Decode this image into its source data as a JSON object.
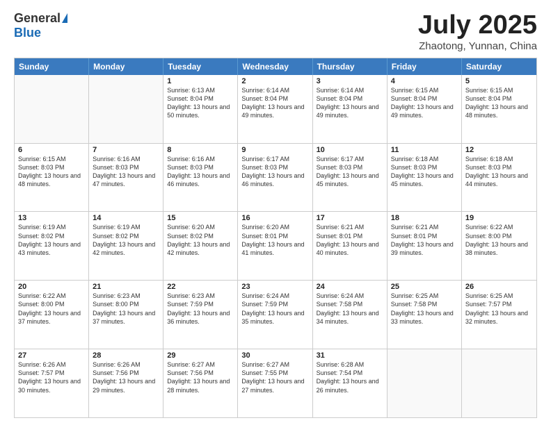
{
  "logo": {
    "general": "General",
    "blue": "Blue"
  },
  "title": {
    "month": "July 2025",
    "location": "Zhaotong, Yunnan, China"
  },
  "header_days": [
    "Sunday",
    "Monday",
    "Tuesday",
    "Wednesday",
    "Thursday",
    "Friday",
    "Saturday"
  ],
  "weeks": [
    [
      {
        "day": "",
        "sunrise": "",
        "sunset": "",
        "daylight": ""
      },
      {
        "day": "",
        "sunrise": "",
        "sunset": "",
        "daylight": ""
      },
      {
        "day": "1",
        "sunrise": "Sunrise: 6:13 AM",
        "sunset": "Sunset: 8:04 PM",
        "daylight": "Daylight: 13 hours and 50 minutes."
      },
      {
        "day": "2",
        "sunrise": "Sunrise: 6:14 AM",
        "sunset": "Sunset: 8:04 PM",
        "daylight": "Daylight: 13 hours and 49 minutes."
      },
      {
        "day": "3",
        "sunrise": "Sunrise: 6:14 AM",
        "sunset": "Sunset: 8:04 PM",
        "daylight": "Daylight: 13 hours and 49 minutes."
      },
      {
        "day": "4",
        "sunrise": "Sunrise: 6:15 AM",
        "sunset": "Sunset: 8:04 PM",
        "daylight": "Daylight: 13 hours and 49 minutes."
      },
      {
        "day": "5",
        "sunrise": "Sunrise: 6:15 AM",
        "sunset": "Sunset: 8:04 PM",
        "daylight": "Daylight: 13 hours and 48 minutes."
      }
    ],
    [
      {
        "day": "6",
        "sunrise": "Sunrise: 6:15 AM",
        "sunset": "Sunset: 8:03 PM",
        "daylight": "Daylight: 13 hours and 48 minutes."
      },
      {
        "day": "7",
        "sunrise": "Sunrise: 6:16 AM",
        "sunset": "Sunset: 8:03 PM",
        "daylight": "Daylight: 13 hours and 47 minutes."
      },
      {
        "day": "8",
        "sunrise": "Sunrise: 6:16 AM",
        "sunset": "Sunset: 8:03 PM",
        "daylight": "Daylight: 13 hours and 46 minutes."
      },
      {
        "day": "9",
        "sunrise": "Sunrise: 6:17 AM",
        "sunset": "Sunset: 8:03 PM",
        "daylight": "Daylight: 13 hours and 46 minutes."
      },
      {
        "day": "10",
        "sunrise": "Sunrise: 6:17 AM",
        "sunset": "Sunset: 8:03 PM",
        "daylight": "Daylight: 13 hours and 45 minutes."
      },
      {
        "day": "11",
        "sunrise": "Sunrise: 6:18 AM",
        "sunset": "Sunset: 8:03 PM",
        "daylight": "Daylight: 13 hours and 45 minutes."
      },
      {
        "day": "12",
        "sunrise": "Sunrise: 6:18 AM",
        "sunset": "Sunset: 8:03 PM",
        "daylight": "Daylight: 13 hours and 44 minutes."
      }
    ],
    [
      {
        "day": "13",
        "sunrise": "Sunrise: 6:19 AM",
        "sunset": "Sunset: 8:02 PM",
        "daylight": "Daylight: 13 hours and 43 minutes."
      },
      {
        "day": "14",
        "sunrise": "Sunrise: 6:19 AM",
        "sunset": "Sunset: 8:02 PM",
        "daylight": "Daylight: 13 hours and 42 minutes."
      },
      {
        "day": "15",
        "sunrise": "Sunrise: 6:20 AM",
        "sunset": "Sunset: 8:02 PM",
        "daylight": "Daylight: 13 hours and 42 minutes."
      },
      {
        "day": "16",
        "sunrise": "Sunrise: 6:20 AM",
        "sunset": "Sunset: 8:01 PM",
        "daylight": "Daylight: 13 hours and 41 minutes."
      },
      {
        "day": "17",
        "sunrise": "Sunrise: 6:21 AM",
        "sunset": "Sunset: 8:01 PM",
        "daylight": "Daylight: 13 hours and 40 minutes."
      },
      {
        "day": "18",
        "sunrise": "Sunrise: 6:21 AM",
        "sunset": "Sunset: 8:01 PM",
        "daylight": "Daylight: 13 hours and 39 minutes."
      },
      {
        "day": "19",
        "sunrise": "Sunrise: 6:22 AM",
        "sunset": "Sunset: 8:00 PM",
        "daylight": "Daylight: 13 hours and 38 minutes."
      }
    ],
    [
      {
        "day": "20",
        "sunrise": "Sunrise: 6:22 AM",
        "sunset": "Sunset: 8:00 PM",
        "daylight": "Daylight: 13 hours and 37 minutes."
      },
      {
        "day": "21",
        "sunrise": "Sunrise: 6:23 AM",
        "sunset": "Sunset: 8:00 PM",
        "daylight": "Daylight: 13 hours and 37 minutes."
      },
      {
        "day": "22",
        "sunrise": "Sunrise: 6:23 AM",
        "sunset": "Sunset: 7:59 PM",
        "daylight": "Daylight: 13 hours and 36 minutes."
      },
      {
        "day": "23",
        "sunrise": "Sunrise: 6:24 AM",
        "sunset": "Sunset: 7:59 PM",
        "daylight": "Daylight: 13 hours and 35 minutes."
      },
      {
        "day": "24",
        "sunrise": "Sunrise: 6:24 AM",
        "sunset": "Sunset: 7:58 PM",
        "daylight": "Daylight: 13 hours and 34 minutes."
      },
      {
        "day": "25",
        "sunrise": "Sunrise: 6:25 AM",
        "sunset": "Sunset: 7:58 PM",
        "daylight": "Daylight: 13 hours and 33 minutes."
      },
      {
        "day": "26",
        "sunrise": "Sunrise: 6:25 AM",
        "sunset": "Sunset: 7:57 PM",
        "daylight": "Daylight: 13 hours and 32 minutes."
      }
    ],
    [
      {
        "day": "27",
        "sunrise": "Sunrise: 6:26 AM",
        "sunset": "Sunset: 7:57 PM",
        "daylight": "Daylight: 13 hours and 30 minutes."
      },
      {
        "day": "28",
        "sunrise": "Sunrise: 6:26 AM",
        "sunset": "Sunset: 7:56 PM",
        "daylight": "Daylight: 13 hours and 29 minutes."
      },
      {
        "day": "29",
        "sunrise": "Sunrise: 6:27 AM",
        "sunset": "Sunset: 7:56 PM",
        "daylight": "Daylight: 13 hours and 28 minutes."
      },
      {
        "day": "30",
        "sunrise": "Sunrise: 6:27 AM",
        "sunset": "Sunset: 7:55 PM",
        "daylight": "Daylight: 13 hours and 27 minutes."
      },
      {
        "day": "31",
        "sunrise": "Sunrise: 6:28 AM",
        "sunset": "Sunset: 7:54 PM",
        "daylight": "Daylight: 13 hours and 26 minutes."
      },
      {
        "day": "",
        "sunrise": "",
        "sunset": "",
        "daylight": ""
      },
      {
        "day": "",
        "sunrise": "",
        "sunset": "",
        "daylight": ""
      }
    ]
  ]
}
